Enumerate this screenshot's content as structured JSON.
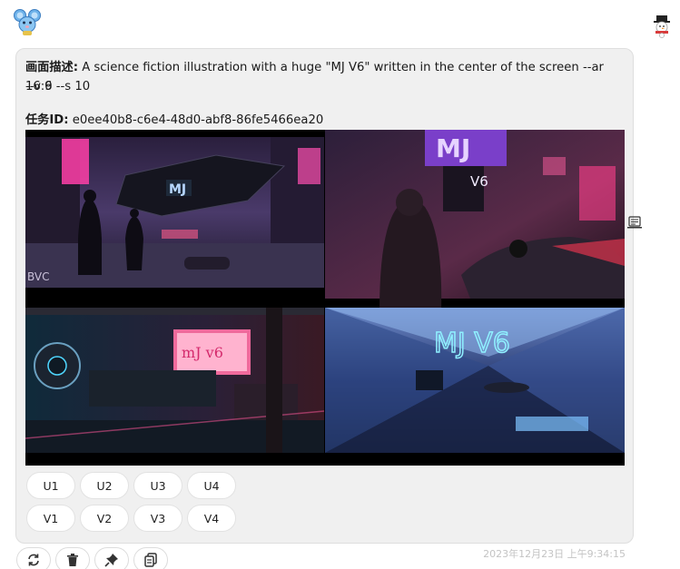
{
  "message": {
    "desc_label": "画面描述:",
    "desc_text_line1": " A science fiction illustration with a huge \"MJ V6\" written in the center of the screen --ar 16:9",
    "desc_text_line2": "--v 6 --s 10",
    "task_label": "任务ID:",
    "task_id": " e0ee40b8-c6e4-48d0-abf8-86fe5466ea20",
    "image_texts": {
      "top_left_sign": "MJ",
      "top_right_sign": "MJ",
      "top_right_label": "V6",
      "bottom_left_sign": "mJ v6",
      "bottom_right_neon": "MJ V6"
    }
  },
  "actions": {
    "upscale": [
      "U1",
      "U2",
      "U3",
      "U4"
    ],
    "variation": [
      "V1",
      "V2",
      "V3",
      "V4"
    ]
  },
  "toolbar": {
    "icons": [
      "refresh-icon",
      "trash-icon",
      "pin-icon",
      "copy-icon"
    ]
  },
  "timestamp": "2023年12月23日 上午9:34:15"
}
